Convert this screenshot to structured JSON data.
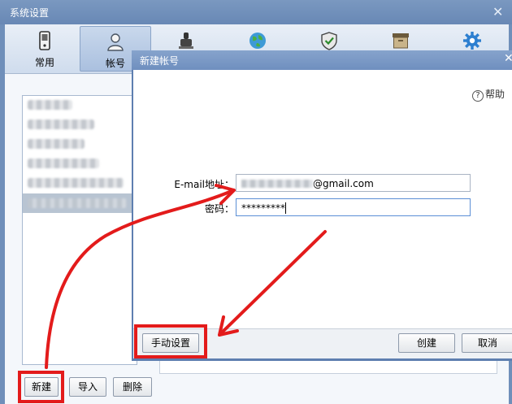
{
  "window": {
    "title": "系统设置",
    "close_glyph": "✕"
  },
  "toolbar": {
    "tabs": [
      {
        "label": "常用",
        "icon": "phone-icon"
      },
      {
        "label": "帐号",
        "icon": "user-icon",
        "active": true
      },
      {
        "label": "",
        "icon": "stamp-icon"
      },
      {
        "label": "",
        "icon": "globe-icon"
      },
      {
        "label": "",
        "icon": "shield-icon"
      },
      {
        "label": "",
        "icon": "archive-icon"
      },
      {
        "label": "",
        "icon": "gear-icon"
      }
    ]
  },
  "account_list": {
    "selected_index": 5
  },
  "buttons": {
    "new": "新建",
    "import": "导入",
    "delete": "删除"
  },
  "dialog": {
    "title": "新建帐号",
    "close_glyph": "✕",
    "help": "帮助",
    "help_glyph": "?",
    "email_label": "E-mail地址：",
    "email_suffix": "@gmail.com",
    "password_label": "密码：",
    "password_value": "*********",
    "manual_setup": "手动设置",
    "create": "创建",
    "cancel": "取消"
  },
  "colors": {
    "highlight": "#e31b1b",
    "titlebar": "#6f8fbf",
    "focus_border": "#5b8fd6"
  }
}
